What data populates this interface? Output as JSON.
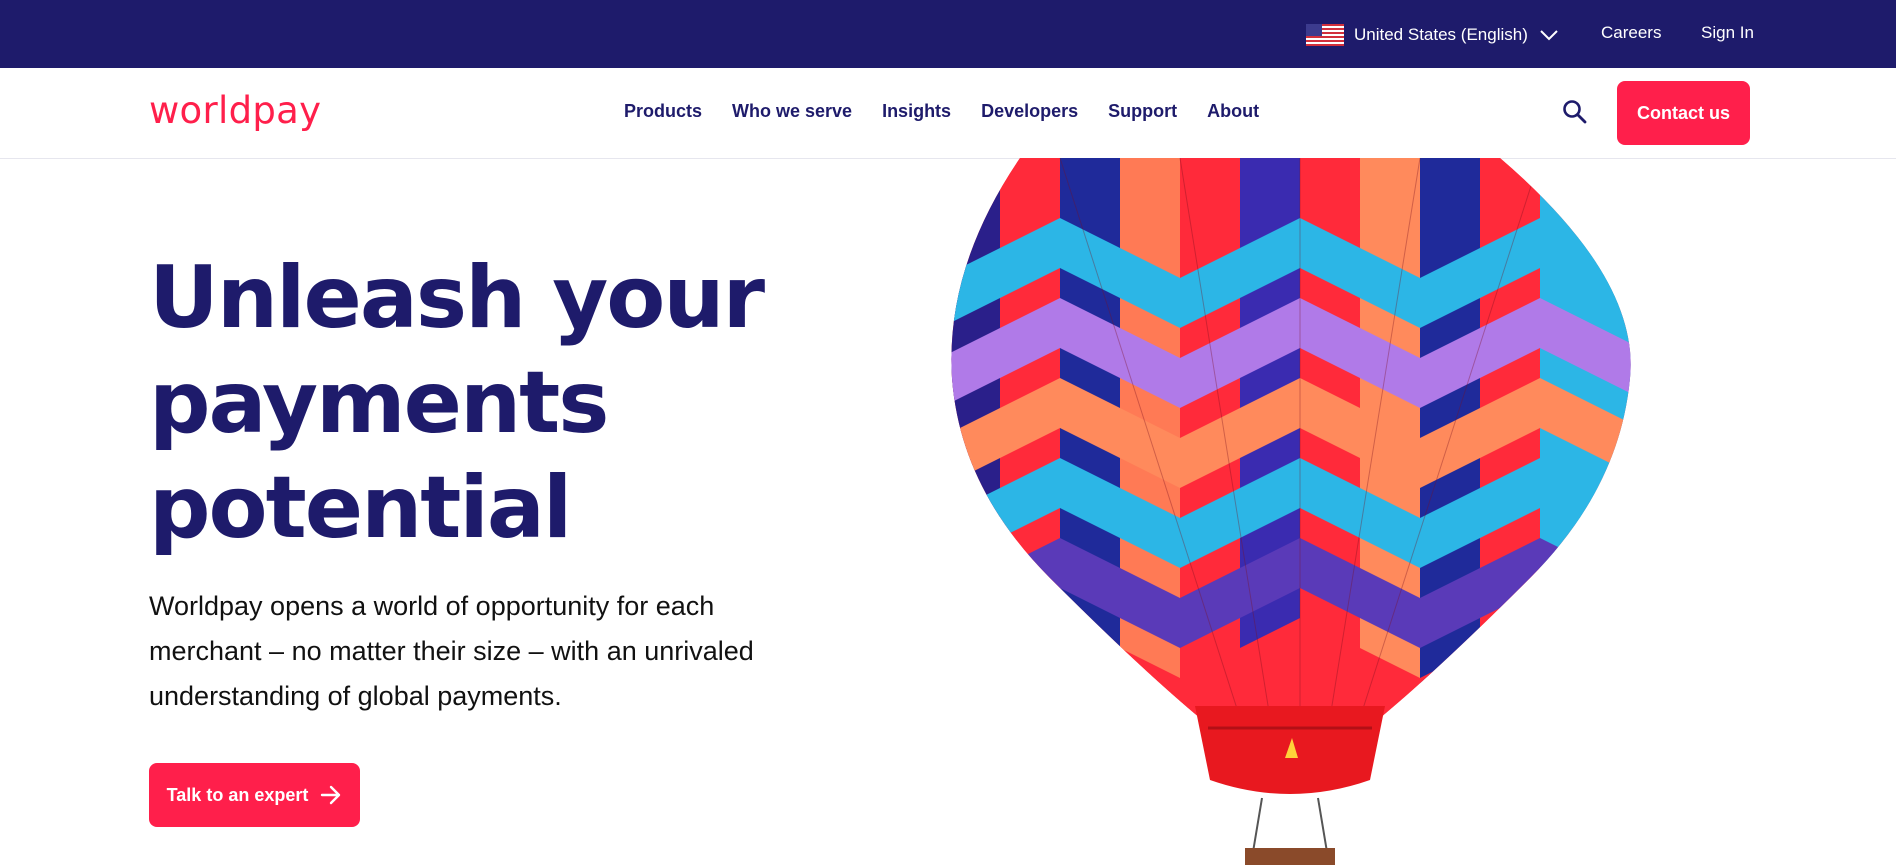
{
  "topbar": {
    "locale_label": "United States (English)",
    "careers_label": "Careers",
    "signin_label": "Sign In"
  },
  "header": {
    "logo_text": "worldpay",
    "nav": [
      {
        "label": "Products"
      },
      {
        "label": "Who we serve"
      },
      {
        "label": "Insights"
      },
      {
        "label": "Developers"
      },
      {
        "label": "Support"
      },
      {
        "label": "About"
      }
    ],
    "contact_label": "Contact us"
  },
  "hero": {
    "title_lines": [
      "Unleash your",
      "payments",
      "potential"
    ],
    "subtitle": "Worldpay opens a world of opportunity for each merchant – no matter their size – with an unrivaled understanding of global payments.",
    "cta_label": "Talk to an expert"
  },
  "icons": {
    "flag": "us-flag-icon",
    "chevron": "chevron-down-icon",
    "search": "search-icon",
    "arrow": "arrow-right-icon"
  },
  "colors": {
    "brand_navy": "#1e1b6b",
    "brand_red": "#ff1f4b",
    "text": "#111111",
    "background": "#ffffff"
  }
}
